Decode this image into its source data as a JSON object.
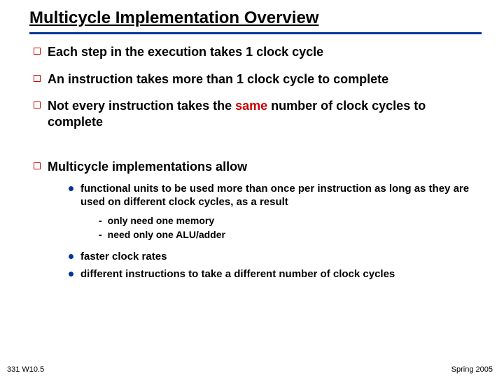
{
  "title": "Multicycle Implementation Overview",
  "bullets": [
    {
      "text": "Each step in the execution takes 1 clock cycle"
    },
    {
      "text": "An instruction takes more than 1 clock cycle to complete"
    },
    {
      "pre": "Not every instruction takes the ",
      "em": "same",
      "post": " number of clock cycles to complete"
    },
    {
      "text": "Multicycle implementations allow"
    }
  ],
  "subs": [
    {
      "text": "functional units to be used more than once per instruction as long as they are used on different clock cycles, as a result"
    },
    {
      "text": "faster clock rates"
    },
    {
      "text": "different instructions to take a different number of clock cycles"
    }
  ],
  "dashes": [
    {
      "text": "only need one memory"
    },
    {
      "text": "need only one ALU/adder"
    }
  ],
  "footer": {
    "left": "331 W10.5",
    "right": "Spring 2005"
  }
}
